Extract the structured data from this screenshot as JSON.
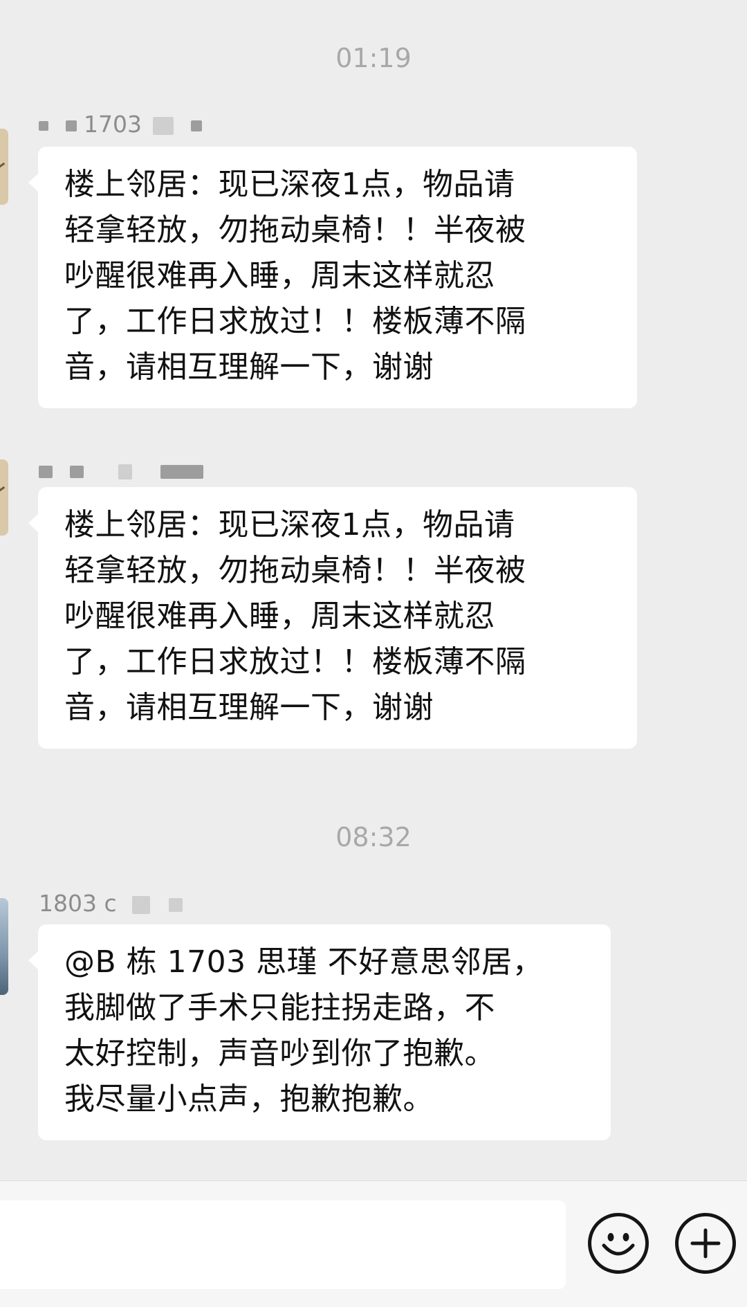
{
  "chat": {
    "time_dividers": [
      "01:19",
      "08:32"
    ],
    "messages": [
      {
        "sender": "1703",
        "text_lines": [
          "楼上邻居：现已深夜1点，物品请",
          "轻拿轻放，勿拖动桌椅！！半夜被",
          "吵醒很难再入睡，周末这样就忍",
          "了，工作日求放过！！楼板薄不隔",
          "音，请相互理解一下，谢谢"
        ]
      },
      {
        "sender": "",
        "text_lines": [
          "楼上邻居：现已深夜1点，物品请",
          "轻拿轻放，勿拖动桌椅！！半夜被",
          "吵醒很难再入睡，周末这样就忍",
          "了，工作日求放过！！楼板薄不隔",
          "音，请相互理解一下，谢谢"
        ]
      },
      {
        "sender": "1803 c",
        "text_lines": [
          "@B 栋 1703 思瑾 不好意思邻居，",
          "我脚做了手术只能拄拐走路，不",
          "太好控制，声音吵到你了抱歉。",
          "我尽量小点声，抱歉抱歉。"
        ]
      }
    ]
  },
  "input_bar": {
    "emoji_icon": "smiley-face-icon",
    "add_icon": "plus-circle-icon"
  },
  "colors": {
    "background": "#ededed",
    "bubble": "#ffffff",
    "time_text": "#a8a8a8",
    "sender_text": "#8c8c8c",
    "message_text": "#111111"
  }
}
